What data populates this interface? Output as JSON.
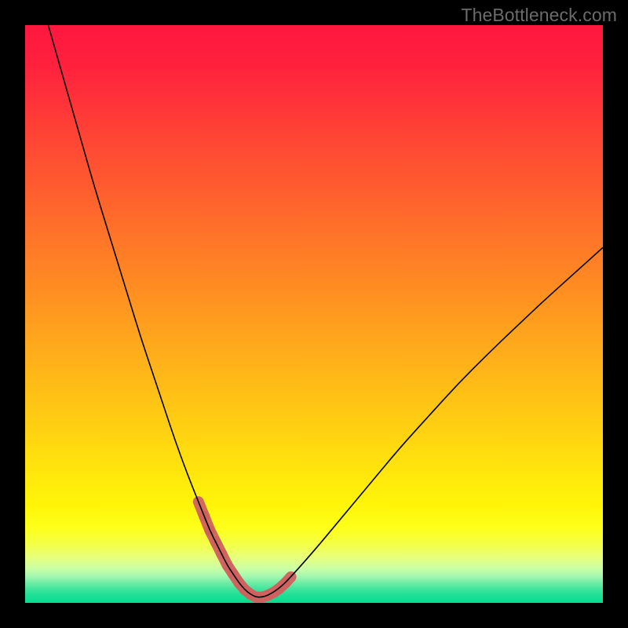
{
  "watermark": "TheBottleneck.com",
  "chart_data": {
    "type": "line",
    "title": "",
    "xlabel": "",
    "ylabel": "",
    "xlim": [
      0,
      100
    ],
    "ylim": [
      0,
      100
    ],
    "grid": false,
    "legend": false,
    "series": [
      {
        "name": "curve",
        "color": "#000000",
        "stroke_width": 1.6,
        "x": [
          4,
          6,
          8,
          10,
          12,
          14,
          16,
          18,
          20,
          22,
          24,
          26,
          28,
          30,
          31,
          32,
          33,
          34,
          35,
          36,
          37,
          38,
          39,
          40,
          41,
          42,
          44,
          46,
          50,
          55,
          60,
          65,
          70,
          75,
          80,
          85,
          90,
          95,
          100
        ],
        "y": [
          100,
          93,
          86,
          79,
          72,
          65.5,
          59,
          52.5,
          46,
          40,
          34,
          28,
          22.5,
          17.5,
          15,
          12.5,
          10.5,
          8.5,
          6.5,
          5,
          3.5,
          2.3,
          1.5,
          1,
          1,
          1.3,
          2.5,
          4.5,
          9,
          15,
          21,
          27,
          32.5,
          38,
          43,
          47.8,
          52.5,
          57,
          61.5
        ]
      },
      {
        "name": "highlight",
        "color": "#d0625f",
        "stroke_width": 14,
        "stroke_linecap": "round",
        "x": [
          30,
          31,
          32,
          33,
          34,
          35,
          36,
          37,
          38,
          39,
          40,
          41,
          42,
          43,
          44,
          45,
          46
        ],
        "y": [
          17.5,
          15,
          12.5,
          10.5,
          8.5,
          6.5,
          5,
          3.5,
          2.3,
          1.5,
          1,
          1,
          1.3,
          1.8,
          2.5,
          3.4,
          4.5
        ]
      }
    ],
    "background_gradient": {
      "type": "vertical",
      "stops": [
        {
          "offset": 0.0,
          "color": "#ff173e"
        },
        {
          "offset": 0.06,
          "color": "#ff1f3e"
        },
        {
          "offset": 0.13,
          "color": "#ff3239"
        },
        {
          "offset": 0.2,
          "color": "#ff4634"
        },
        {
          "offset": 0.27,
          "color": "#ff592f"
        },
        {
          "offset": 0.34,
          "color": "#ff6d2a"
        },
        {
          "offset": 0.41,
          "color": "#ff8025"
        },
        {
          "offset": 0.48,
          "color": "#ff9420"
        },
        {
          "offset": 0.55,
          "color": "#ffa81c"
        },
        {
          "offset": 0.62,
          "color": "#ffbb17"
        },
        {
          "offset": 0.69,
          "color": "#ffce12"
        },
        {
          "offset": 0.76,
          "color": "#ffe20d"
        },
        {
          "offset": 0.83,
          "color": "#fff508"
        },
        {
          "offset": 0.87,
          "color": "#feff1a"
        },
        {
          "offset": 0.9,
          "color": "#f3ff4a"
        },
        {
          "offset": 0.92,
          "color": "#e8ff7a"
        },
        {
          "offset": 0.94,
          "color": "#ccffa5"
        },
        {
          "offset": 0.955,
          "color": "#a0f7b0"
        },
        {
          "offset": 0.965,
          "color": "#70eca6"
        },
        {
          "offset": 0.975,
          "color": "#45e59e"
        },
        {
          "offset": 0.985,
          "color": "#22e096"
        },
        {
          "offset": 1.0,
          "color": "#04dc8e"
        }
      ]
    }
  }
}
